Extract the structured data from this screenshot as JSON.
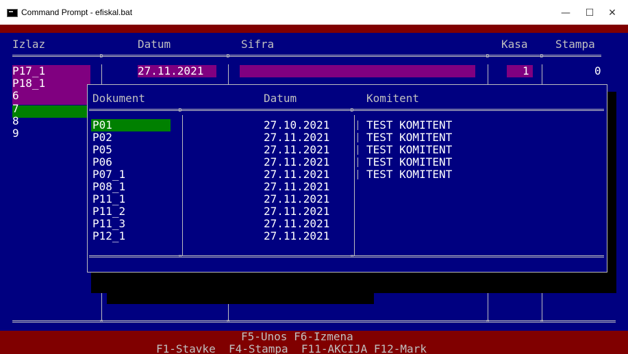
{
  "window": {
    "title": "Command Prompt - efiskal.bat"
  },
  "main": {
    "headers": [
      "Izlaz",
      "Datum",
      "Sifra",
      "Kasa",
      "Stampa"
    ],
    "current": {
      "izlaz": "P17_1",
      "datum": "27.11.2021",
      "sifra": "",
      "kasa": "1",
      "stampa": "0"
    },
    "list": [
      "P18_1",
      "6",
      "7",
      "8",
      "9"
    ]
  },
  "popup": {
    "headers": [
      "Dokument",
      "Datum",
      "Komitent"
    ],
    "rows": [
      {
        "doc": "P01",
        "datum": "27.10.2021",
        "komitent": "TEST KOMITENT"
      },
      {
        "doc": "P02",
        "datum": "27.11.2021",
        "komitent": "TEST KOMITENT"
      },
      {
        "doc": "P05",
        "datum": "27.11.2021",
        "komitent": "TEST KOMITENT"
      },
      {
        "doc": "P06",
        "datum": "27.11.2021",
        "komitent": "TEST KOMITENT"
      },
      {
        "doc": "P07_1",
        "datum": "27.11.2021",
        "komitent": "TEST KOMITENT"
      },
      {
        "doc": "P08_1",
        "datum": "27.11.2021",
        "komitent": ""
      },
      {
        "doc": "P11_1",
        "datum": "27.11.2021",
        "komitent": ""
      },
      {
        "doc": "P11_2",
        "datum": "27.11.2021",
        "komitent": ""
      },
      {
        "doc": "P11_3",
        "datum": "27.11.2021",
        "komitent": ""
      },
      {
        "doc": "P12_1",
        "datum": "27.11.2021",
        "komitent": ""
      }
    ]
  },
  "footer": {
    "line1": "F5-Unos F6-Izmena",
    "line2": "F1-Stavke  F4-Stampa  F11-AKCIJA F12-Mark"
  },
  "colors": {
    "console_bg": "#000080",
    "text": "#c0c0c0",
    "highlight_magenta": "#800080",
    "highlight_green": "#008000",
    "status_red": "#800000"
  }
}
